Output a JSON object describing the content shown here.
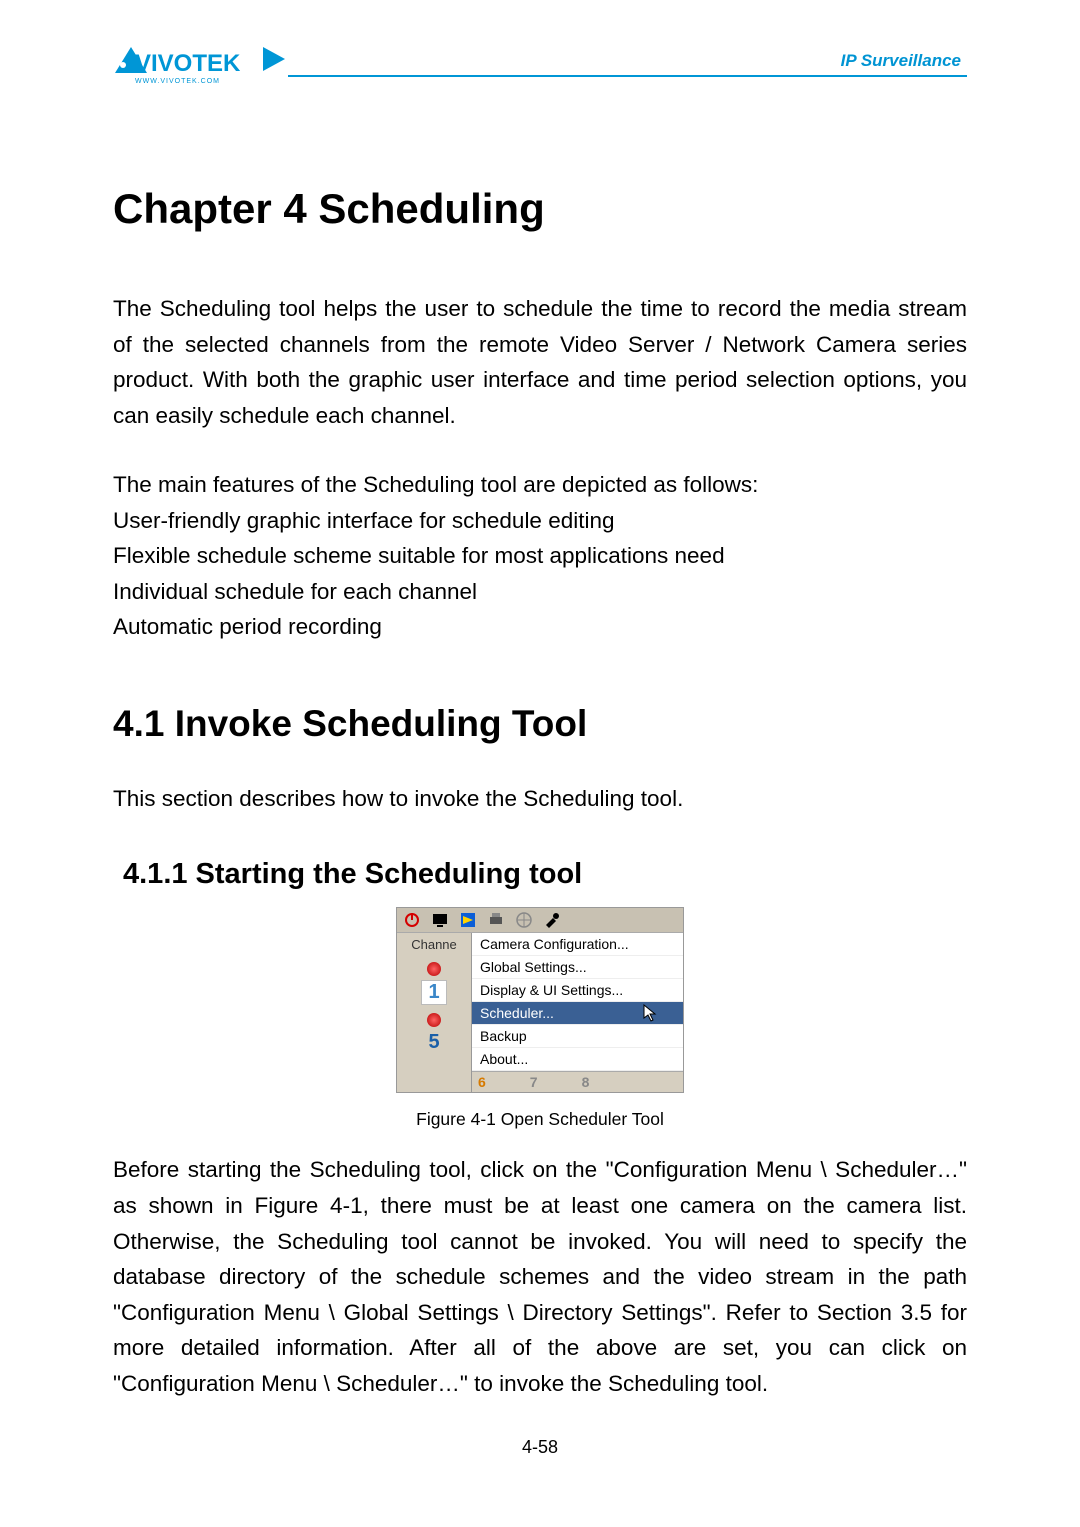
{
  "header": {
    "brand": "VIVOTEK",
    "brand_sub": "WWW.VIVOTEK.COM",
    "tag": "IP Surveillance"
  },
  "chapter": {
    "title": "Chapter 4 Scheduling",
    "para1": "The Scheduling tool helps the user to schedule the time to record the media stream of the selected channels from the remote Video Server / Network Camera series product. With both the graphic user interface and time period selection options, you can easily schedule each channel.",
    "features_intro": "The main features of the Scheduling tool are depicted as follows:",
    "features": [
      "User-friendly graphic interface for schedule editing",
      "Flexible schedule scheme suitable for most applications need",
      "Individual schedule for each channel",
      "Automatic period recording"
    ]
  },
  "section": {
    "title": "4.1  Invoke Scheduling Tool",
    "body": "This section describes how to invoke the Scheduling tool."
  },
  "subsection": {
    "title": "4.1.1  Starting the Scheduling tool"
  },
  "screenshot": {
    "channel_label": "Channe",
    "num1": "1",
    "num5": "5",
    "menu": {
      "camera_config": "Camera Configuration...",
      "global_settings": "Global Settings...",
      "display_ui": "Display & UI Settings...",
      "scheduler": "Scheduler...",
      "backup": "Backup",
      "about": "About..."
    },
    "bottom": {
      "b6": "6",
      "b7": "7",
      "b8": "8"
    }
  },
  "figure_caption": "Figure 4-1 Open Scheduler Tool",
  "para2": "Before starting the Scheduling tool, click on the \"Configuration Menu \\ Scheduler…\" as shown in Figure 4-1, there must be at least one camera on the camera list. Otherwise, the Scheduling tool cannot be invoked. You will need to specify the database directory of the schedule schemes and the video stream in the path \"Configuration Menu \\ Global Settings \\ Directory Settings\". Refer to Section 3.5 for more detailed information. After all of the above are set, you can click on \"Configuration Menu \\ Scheduler…\" to invoke the Scheduling tool.",
  "page_number": "4-58"
}
